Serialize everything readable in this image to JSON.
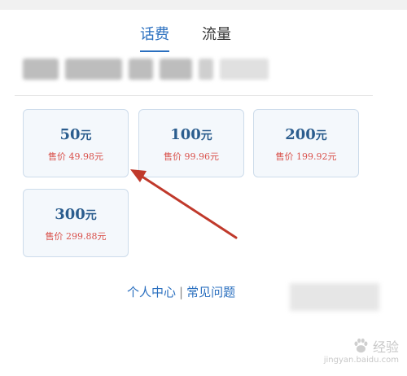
{
  "tabs": [
    {
      "label": "话费",
      "active": true
    },
    {
      "label": "流量",
      "active": false
    }
  ],
  "cards": [
    {
      "amount": "50",
      "unit": "元",
      "price": "售价 49.98元"
    },
    {
      "amount": "100",
      "unit": "元",
      "price": "售价 99.96元"
    },
    {
      "amount": "200",
      "unit": "元",
      "price": "售价 199.92元"
    },
    {
      "amount": "300",
      "unit": "元",
      "price": "售价 299.88元"
    }
  ],
  "footer": {
    "personal_center": "个人中心",
    "separator": "|",
    "faq": "常见问题"
  },
  "watermark": {
    "main": "经验",
    "sub": "jingyan.baidu.com"
  },
  "colors": {
    "accent": "#2a6fbf",
    "amount": "#2b5d8e",
    "price": "#d9504a",
    "arrow": "#c0392b",
    "card_bg": "#f4f8fc",
    "card_border": "#cddceb"
  }
}
